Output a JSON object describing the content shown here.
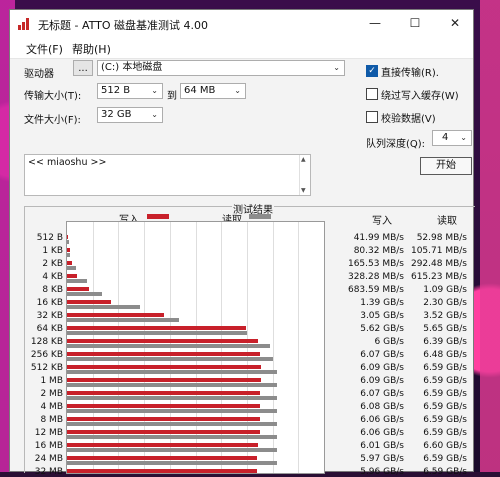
{
  "window": {
    "title": "无标题 - ATTO 磁盘基准测试 4.00",
    "minimize": "—",
    "maximize": "☐",
    "close": "✕"
  },
  "menu": [
    "文件(F)",
    "帮助(H)"
  ],
  "drive": {
    "label": "驱动器",
    "browse": "...",
    "value": "(C:) 本地磁盘"
  },
  "transfer": {
    "label": "传输大小(T):",
    "from": "512 B",
    "to_label": "到",
    "to": "64 MB"
  },
  "filesize": {
    "label": "文件大小(F):",
    "value": "32 GB"
  },
  "options": {
    "direct_io": {
      "label": "直接传输(R).",
      "checked": true
    },
    "bypass_cache": {
      "label": "绕过写入缓存(W)",
      "checked": false
    },
    "verify": {
      "label": "校验数据(V)",
      "checked": false
    },
    "queue_label": "队列深度(Q):",
    "queue_value": "4",
    "start": "开始"
  },
  "memo": {
    "text": "<< miaoshu >>"
  },
  "results": {
    "title": "测试结果",
    "write_label": "写入",
    "read_label": "读取",
    "write_header": "写入",
    "read_header": "读取",
    "write_color": "#c8202a",
    "read_color": "#8c8c8c",
    "rows": [
      {
        "size": "512 B",
        "write": "41.99 MB/s",
        "read": "52.98 MB/s",
        "write_mbps": 41.99,
        "read_mbps": 52.98
      },
      {
        "size": "1 KB",
        "write": "80.32 MB/s",
        "read": "105.71 MB/s",
        "write_mbps": 80.32,
        "read_mbps": 105.71
      },
      {
        "size": "2 KB",
        "write": "165.53 MB/s",
        "read": "292.48 MB/s",
        "write_mbps": 165.53,
        "read_mbps": 292.48
      },
      {
        "size": "4 KB",
        "write": "328.28 MB/s",
        "read": "615.23 MB/s",
        "write_mbps": 328.28,
        "read_mbps": 615.23
      },
      {
        "size": "8 KB",
        "write": "683.59 MB/s",
        "read": "1.09 GB/s",
        "write_mbps": 683.59,
        "read_mbps": 1090
      },
      {
        "size": "16 KB",
        "write": "1.39 GB/s",
        "read": "2.30 GB/s",
        "write_mbps": 1390,
        "read_mbps": 2300
      },
      {
        "size": "32 KB",
        "write": "3.05 GB/s",
        "read": "3.52 GB/s",
        "write_mbps": 3050,
        "read_mbps": 3520
      },
      {
        "size": "64 KB",
        "write": "5.62 GB/s",
        "read": "5.65 GB/s",
        "write_mbps": 5620,
        "read_mbps": 5650
      },
      {
        "size": "128 KB",
        "write": "6 GB/s",
        "read": "6.39 GB/s",
        "write_mbps": 6000,
        "read_mbps": 6390
      },
      {
        "size": "256 KB",
        "write": "6.07 GB/s",
        "read": "6.48 GB/s",
        "write_mbps": 6070,
        "read_mbps": 6480
      },
      {
        "size": "512 KB",
        "write": "6.09 GB/s",
        "read": "6.59 GB/s",
        "write_mbps": 6090,
        "read_mbps": 6590
      },
      {
        "size": "1 MB",
        "write": "6.09 GB/s",
        "read": "6.59 GB/s",
        "write_mbps": 6090,
        "read_mbps": 6590
      },
      {
        "size": "2 MB",
        "write": "6.07 GB/s",
        "read": "6.59 GB/s",
        "write_mbps": 6070,
        "read_mbps": 6590
      },
      {
        "size": "4 MB",
        "write": "6.08 GB/s",
        "read": "6.59 GB/s",
        "write_mbps": 6080,
        "read_mbps": 6590
      },
      {
        "size": "8 MB",
        "write": "6.06 GB/s",
        "read": "6.59 GB/s",
        "write_mbps": 6060,
        "read_mbps": 6590
      },
      {
        "size": "12 MB",
        "write": "6.06 GB/s",
        "read": "6.59 GB/s",
        "write_mbps": 6060,
        "read_mbps": 6590
      },
      {
        "size": "16 MB",
        "write": "6.01 GB/s",
        "read": "6.60 GB/s",
        "write_mbps": 6010,
        "read_mbps": 6600
      },
      {
        "size": "24 MB",
        "write": "5.97 GB/s",
        "read": "6.59 GB/s",
        "write_mbps": 5970,
        "read_mbps": 6590
      },
      {
        "size": "32 MB",
        "write": "5.96 GB/s",
        "read": "6.59 GB/s",
        "write_mbps": 5960,
        "read_mbps": 6590
      }
    ]
  }
}
